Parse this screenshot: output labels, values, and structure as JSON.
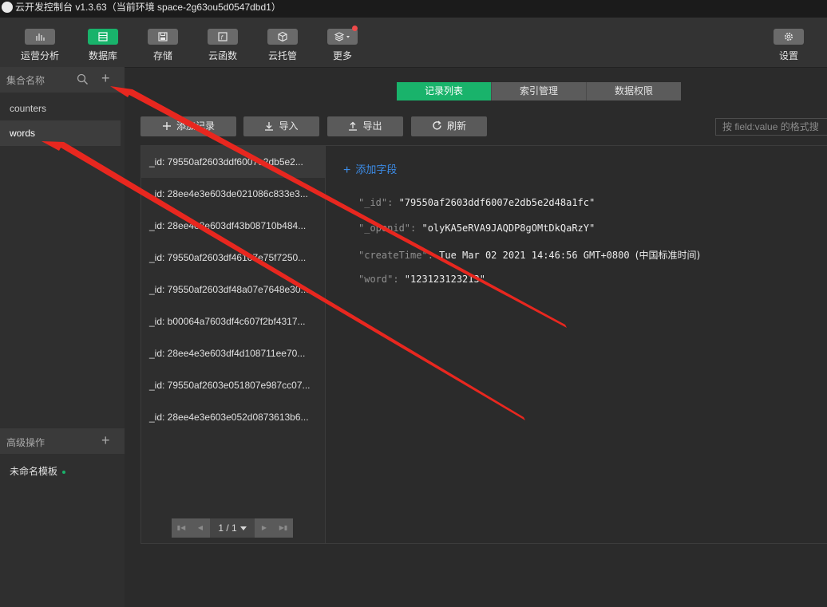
{
  "window": {
    "title": "云开发控制台 v1.3.63（当前环境 space-2g63ou5d0547dbd1）"
  },
  "toolbar": {
    "items": [
      {
        "label": "运营分析",
        "icon": "bar-chart-icon"
      },
      {
        "label": "数据库",
        "icon": "database-icon",
        "active": true
      },
      {
        "label": "存储",
        "icon": "storage-icon"
      },
      {
        "label": "云函数",
        "icon": "function-icon"
      },
      {
        "label": "云托管",
        "icon": "cube-icon"
      },
      {
        "label": "更多",
        "icon": "layers-icon",
        "badge": true
      }
    ],
    "settings": {
      "label": "设置",
      "icon": "gear-icon"
    }
  },
  "sidebar": {
    "title": "集合名称",
    "collections": [
      "counters",
      "words"
    ],
    "selected": "words",
    "advanced_title": "高级操作",
    "templates": [
      "未命名模板"
    ]
  },
  "tabs": [
    "记录列表",
    "索引管理",
    "数据权限"
  ],
  "active_tab": "记录列表",
  "actions": {
    "add": "添加记录",
    "import": "导入",
    "export": "导出",
    "refresh": "刷新"
  },
  "search": {
    "placeholder": "按 field:value 的格式搜"
  },
  "records": [
    "_id: 79550af2603ddf6007e2db5e2...",
    "_id: 28ee4e3e603de021086c833e3...",
    "_id: 28ee4e3e603df43b08710b484...",
    "_id: 79550af2603df46107e75f7250...",
    "_id: 79550af2603df48a07e7648e30...",
    "_id: b00064a7603df4c607f2bf4317...",
    "_id: 28ee4e3e603df4d108711ee70...",
    "_id: 79550af2603e051807e987cc07...",
    "_id: 28ee4e3e603e052d0873613b6..."
  ],
  "pagination": {
    "label": "1 / 1"
  },
  "document": {
    "add_field": "添加字段",
    "fields": [
      {
        "key": "\"_id\": ",
        "value": "\"79550af2603ddf6007e2db5e2d48a1fc\""
      },
      {
        "key": "\"_openid\": ",
        "value": "\"olyKA5eRVA9JAQDP8gOMtDkQaRzY\""
      },
      {
        "key": "\"createTime\": ",
        "value": "Tue Mar 02 2021 14:46:56 GMT+0800 ",
        "suffix": "(中国标准时间)"
      },
      {
        "key": "\"word\": ",
        "value": "\"123123123213\""
      }
    ]
  },
  "colors": {
    "accent": "#19b36b",
    "link": "#3c8ce7",
    "annotation_arrow": "#e8271f"
  }
}
